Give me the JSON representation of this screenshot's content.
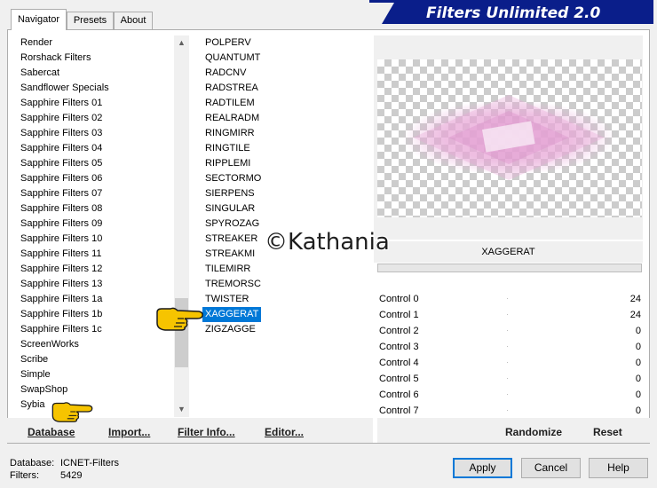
{
  "title": "Filters Unlimited 2.0",
  "tabs": [
    {
      "label": "Navigator",
      "active": true
    },
    {
      "label": "Presets",
      "active": false
    },
    {
      "label": "About",
      "active": false
    }
  ],
  "categories": [
    "Render",
    "Rorshack Filters",
    "Sabercat",
    "Sandflower Specials",
    "Sapphire Filters 01",
    "Sapphire Filters 02",
    "Sapphire Filters 03",
    "Sapphire Filters 04",
    "Sapphire Filters 05",
    "Sapphire Filters 06",
    "Sapphire Filters 07",
    "Sapphire Filters 08",
    "Sapphire Filters 09",
    "Sapphire Filters 10",
    "Sapphire Filters 11",
    "Sapphire Filters 12",
    "Sapphire Filters 13",
    "Sapphire Filters 1a",
    "Sapphire Filters 1b",
    "Sapphire Filters 1c",
    "ScreenWorks",
    "Scribe",
    "Simple",
    "SwapShop",
    "Sybia"
  ],
  "filters": [
    "POLPERV",
    "QUANTUMT",
    "RADCNV",
    "RADSTREA",
    "RADTILEM",
    "REALRADM",
    "RINGMIRR",
    "RINGTILE",
    "RIPPLEMI",
    "SECTORMO",
    "SIERPENS",
    "SINGULAR",
    "SPYROZAG",
    "STREAKER",
    "STREAKMI",
    "TILEMIRR",
    "TREMORSC",
    "TWISTER",
    "XAGGERAT",
    "ZIGZAGGE"
  ],
  "selected_filter": "XAGGERAT",
  "filter_name_display": "XAGGERAT",
  "controls": [
    {
      "label": "Control 0",
      "value": "24"
    },
    {
      "label": "Control 1",
      "value": "24"
    },
    {
      "label": "Control 2",
      "value": "0"
    },
    {
      "label": "Control 3",
      "value": "0"
    },
    {
      "label": "Control 4",
      "value": "0"
    },
    {
      "label": "Control 5",
      "value": "0"
    },
    {
      "label": "Control 6",
      "value": "0"
    },
    {
      "label": "Control 7",
      "value": "0"
    }
  ],
  "left_buttons": {
    "database": "Database",
    "import": "Import...",
    "filter_info": "Filter Info...",
    "editor": "Editor..."
  },
  "right_buttons": {
    "randomize": "Randomize",
    "reset": "Reset"
  },
  "dialog_buttons": {
    "apply": "Apply",
    "cancel": "Cancel",
    "help": "Help"
  },
  "status": {
    "database_label": "Database:",
    "database_value": "ICNET-Filters",
    "filters_label": "Filters:",
    "filters_value": "5429"
  },
  "watermark": "©Kathania",
  "icons": {
    "pointer_hand": "pointing-hand-icon",
    "scroll_up": "chevron-up-icon",
    "scroll_down": "chevron-down-icon"
  },
  "colors": {
    "banner": "#0a1e8a",
    "selection": "#0078d7",
    "preview_tint": "#e8a6d8"
  }
}
